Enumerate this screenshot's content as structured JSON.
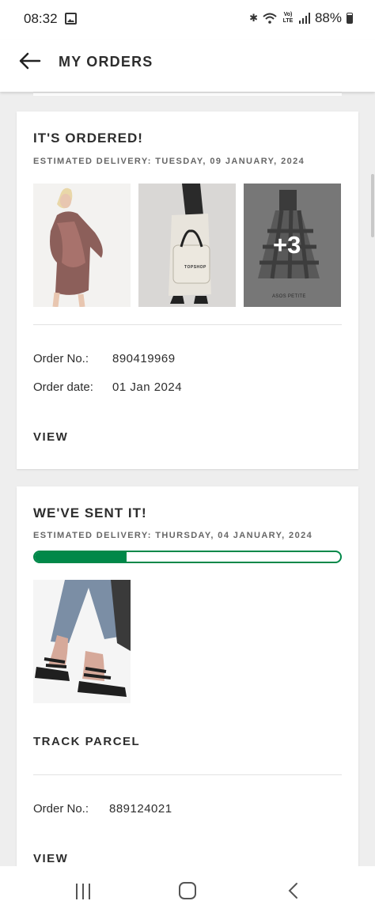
{
  "status_bar": {
    "time": "08:32",
    "net_label": "Vo) LTE",
    "battery": "88%"
  },
  "header": {
    "title": "MY ORDERS"
  },
  "orders": [
    {
      "title": "IT'S ORDERED!",
      "estimated_delivery": "ESTIMATED DELIVERY: TUESDAY, 09 JANUARY, 2024",
      "thumbnails": [
        {
          "alt": "patterned mini dress",
          "label": ""
        },
        {
          "alt": "tote bag outfit",
          "label": "TOPSHOP"
        },
        {
          "alt": "checked skirt",
          "label": "ASOS PETITE",
          "more_count": "+3"
        }
      ],
      "order_no_label": "Order No.:",
      "order_no": "890419969",
      "order_date_label": "Order date:",
      "order_date": "01 Jan 2024",
      "view_label": "VIEW"
    },
    {
      "title": "WE'VE SENT IT!",
      "estimated_delivery": "ESTIMATED DELIVERY: THURSDAY, 04 JANUARY, 2024",
      "progress_percent": 30,
      "thumbnails": [
        {
          "alt": "chunky sandals"
        }
      ],
      "track_label": "TRACK PARCEL",
      "order_no_label": "Order No.:",
      "order_no": "889124021",
      "view_label": "VIEW"
    }
  ],
  "colors": {
    "accent": "#018849",
    "text": "#2d2d2d",
    "background": "#eeeeee"
  }
}
